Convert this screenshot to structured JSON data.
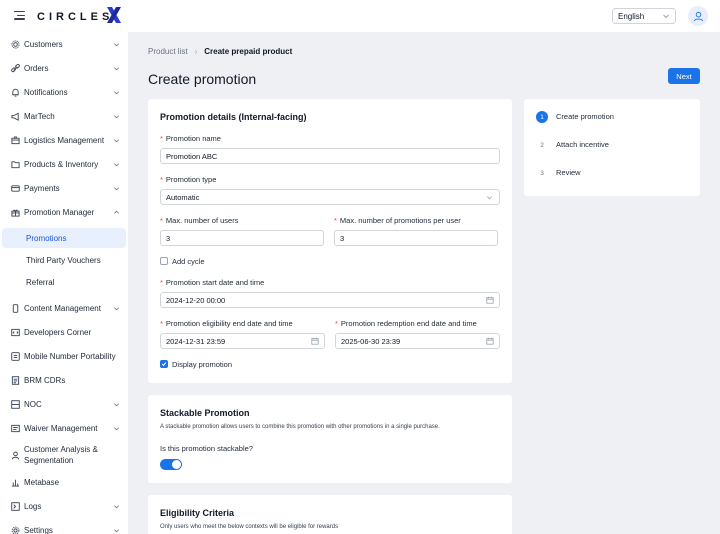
{
  "header": {
    "logo_text": "CIRCLES",
    "language": "English"
  },
  "sidebar": {
    "items": [
      {
        "label": "Customers",
        "icon": "settings-icon"
      },
      {
        "label": "Orders",
        "icon": "link-icon"
      },
      {
        "label": "Notifications",
        "icon": "bell-icon"
      },
      {
        "label": "MarTech",
        "icon": "megaphone-icon"
      },
      {
        "label": "Logistics Management",
        "icon": "box-icon"
      },
      {
        "label": "Products & Inventory",
        "icon": "folder-icon"
      },
      {
        "label": "Payments",
        "icon": "card-icon"
      },
      {
        "label": "Promotion Manager",
        "icon": "gift-icon"
      },
      {
        "label": "Content Management",
        "icon": "phone-icon"
      },
      {
        "label": "Developers Corner",
        "icon": "code-icon"
      },
      {
        "label": "Mobile Number Portability",
        "icon": "transfer-icon"
      },
      {
        "label": "BRM CDRs",
        "icon": "document-icon"
      },
      {
        "label": "NOC",
        "icon": "layers-icon"
      },
      {
        "label": "Waiver Management",
        "icon": "receipt-icon"
      },
      {
        "label": "Customer Analysis & Segmentation",
        "icon": "user-icon"
      },
      {
        "label": "Metabase",
        "icon": "chart-icon"
      },
      {
        "label": "Logs",
        "icon": "log-icon"
      },
      {
        "label": "Settings",
        "icon": "gear-icon"
      }
    ],
    "sub_items": [
      {
        "label": "Promotions",
        "active": true
      },
      {
        "label": "Third Party Vouchers",
        "active": false
      },
      {
        "label": "Referral",
        "active": false
      }
    ]
  },
  "breadcrumb": {
    "parent": "Product list",
    "current": "Create prepaid product"
  },
  "page": {
    "title": "Create promotion",
    "next_label": "Next"
  },
  "details": {
    "title": "Promotion details (Internal-facing)",
    "name_label": "Promotion name",
    "name_value": "Promotion ABC",
    "type_label": "Promotion type",
    "type_value": "Automatic",
    "max_users_label": "Max. number of users",
    "max_users_value": "3",
    "max_per_user_label": "Max. number of promotions per user",
    "max_per_user_value": "3",
    "add_cycle_label": "Add cycle",
    "start_label": "Promotion start date and time",
    "start_value": "2024-12-20 00:00",
    "elig_end_label": "Promotion eligibility end date and time",
    "elig_end_value": "2024-12-31 23:59",
    "redeem_end_label": "Promotion redemption end date and time",
    "redeem_end_value": "2025-06-30 23:39",
    "display_label": "Display promotion",
    "display_checked": true,
    "add_cycle_checked": false
  },
  "stackable": {
    "title": "Stackable Promotion",
    "desc": "A stackable promotion allows users to combine this promotion with other promotions in a single purchase.",
    "question": "Is this promotion stackable?",
    "enabled": true
  },
  "eligibility": {
    "title": "Eligibility Criteria",
    "desc": "Only users who meet the below contexts will be eligible for rewards"
  },
  "steps": [
    {
      "num": "1",
      "label": "Create promotion",
      "active": true
    },
    {
      "num": "2",
      "label": "Attach incentive",
      "active": false
    },
    {
      "num": "3",
      "label": "Review",
      "active": false
    }
  ],
  "colors": {
    "accent": "#1a73e8",
    "active_bg": "#e8f0fd",
    "required": "#ef4444"
  }
}
